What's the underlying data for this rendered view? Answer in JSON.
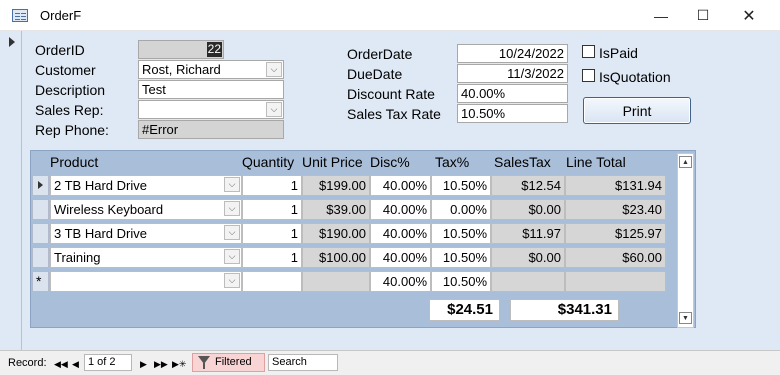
{
  "window": {
    "title": "OrderF"
  },
  "form": {
    "order_id_label": "OrderID",
    "order_id": "22",
    "customer_label": "Customer",
    "customer": "Rost, Richard",
    "description_label": "Description",
    "description": "Test",
    "sales_rep_label": "Sales Rep:",
    "sales_rep": "",
    "rep_phone_label": "Rep Phone:",
    "rep_phone": "#Error",
    "order_date_label": "OrderDate",
    "order_date": "10/24/2022",
    "due_date_label": "DueDate",
    "due_date": "11/3/2022",
    "discount_rate_label": "Discount Rate",
    "discount_rate": "40.00%",
    "sales_tax_rate_label": "Sales Tax Rate",
    "sales_tax_rate": "10.50%",
    "is_paid_label": "IsPaid",
    "is_quotation_label": "IsQuotation",
    "print_label": "Print"
  },
  "subform": {
    "headers": {
      "product": "Product",
      "quantity": "Quantity",
      "unit_price": "Unit Price",
      "disc": "Disc%",
      "tax": "Tax%",
      "sales_tax": "SalesTax",
      "line_total": "Line Total"
    },
    "rows": [
      {
        "product": "2 TB Hard Drive",
        "quantity": "1",
        "unit_price": "$199.00",
        "disc": "40.00%",
        "tax": "10.50%",
        "sales_tax": "$12.54",
        "line_total": "$131.94"
      },
      {
        "product": "Wireless Keyboard",
        "quantity": "1",
        "unit_price": "$39.00",
        "disc": "40.00%",
        "tax": "0.00%",
        "sales_tax": "$0.00",
        "line_total": "$23.40"
      },
      {
        "product": "3 TB Hard Drive",
        "quantity": "1",
        "unit_price": "$190.00",
        "disc": "40.00%",
        "tax": "10.50%",
        "sales_tax": "$11.97",
        "line_total": "$125.97"
      },
      {
        "product": "Training",
        "quantity": "1",
        "unit_price": "$100.00",
        "disc": "40.00%",
        "tax": "10.50%",
        "sales_tax": "$0.00",
        "line_total": "$60.00"
      },
      {
        "product": "",
        "quantity": "",
        "unit_price": "",
        "disc": "40.00%",
        "tax": "10.50%",
        "sales_tax": "",
        "line_total": ""
      }
    ],
    "new_record_marker": "*",
    "total_sales_tax": "$24.51",
    "grand_total": "$341.31"
  },
  "nav": {
    "record_label": "Record:",
    "position": "1 of 2",
    "filtered_label": "Filtered",
    "search_placeholder": "Search"
  }
}
